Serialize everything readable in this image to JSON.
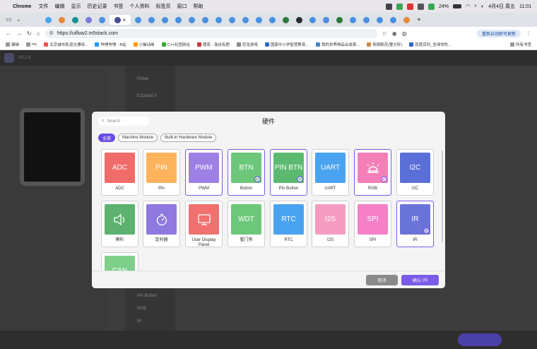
{
  "menubar": {
    "app": "Chrome",
    "items": [
      "文件",
      "编辑",
      "显示",
      "历史记录",
      "书签",
      "个人资料",
      "标签页",
      "窗口",
      "帮助"
    ],
    "battery": "24%",
    "datetime": "4月4日 周五",
    "time": "11:01"
  },
  "browser": {
    "url": "https://uiflow2.m5stack.com",
    "update_label": "重新启动即可更新",
    "bookmarks": [
      "编辑",
      "mc",
      "北京城市轨道交通线...",
      "哔哩哔哩 - B站",
      "小猫动画",
      "C++社团网站",
      "题库 - 洛谷有题",
      "恐龙游戏",
      "国家中小学智慧教育...",
      "我的世界物品合成表...",
      "青钢梨花(曹文轩)",
      "百度百科_全球领先..."
    ],
    "all_bookmarks": "所有书签"
  },
  "app": {
    "version": "V2.2.6",
    "blocks": [
      "Power",
      "EzData2.0",
      "Pin Button",
      "RGB",
      "IR"
    ]
  },
  "modal": {
    "title": "硬件",
    "search_placeholder": "Search",
    "filters": [
      "全部",
      "Machine Module",
      "Built-in Hardware Module"
    ],
    "cards": [
      {
        "thumb": "ADC",
        "label": "ADC",
        "color": "#f26b6b",
        "selected": false
      },
      {
        "thumb": "PIN",
        "label": "Pin",
        "color": "#fdb45c",
        "selected": false
      },
      {
        "thumb": "PWM",
        "label": "PWM",
        "color": "#9d7fe6",
        "selected": true
      },
      {
        "thumb": "BTN",
        "label": "Button",
        "color": "#6cc77a",
        "selected": true
      },
      {
        "thumb": "PIN BTN",
        "label": "Pin Button",
        "color": "#5cba70",
        "selected": true
      },
      {
        "thumb": "UART",
        "label": "UART",
        "color": "#4aa3f0",
        "selected": false
      },
      {
        "thumb": "",
        "label": "RGB",
        "color": "#f580b8",
        "selected": true
      },
      {
        "thumb": "I2C",
        "label": "I2C",
        "color": "#5b6fd8",
        "selected": false
      },
      {
        "thumb": "",
        "label": "喇叭",
        "color": "#5cb26e",
        "selected": false
      },
      {
        "thumb": "",
        "label": "定时器",
        "color": "#8f78e0",
        "selected": false
      },
      {
        "thumb": "",
        "label": "User Display Panel",
        "color": "#f17070",
        "selected": false
      },
      {
        "thumb": "WDT",
        "label": "看门狗",
        "color": "#6cc77a",
        "selected": false
      },
      {
        "thumb": "RTC",
        "label": "RTC",
        "color": "#4aa3f0",
        "selected": false
      },
      {
        "thumb": "I2S",
        "label": "I2S",
        "color": "#f59cc0",
        "selected": false
      },
      {
        "thumb": "SPI",
        "label": "SPI",
        "color": "#f580c8",
        "selected": false
      },
      {
        "thumb": "IR",
        "label": "IR",
        "color": "#6a74d8",
        "selected": true
      },
      {
        "thumb": "CAN",
        "label": "",
        "color": "#7ecf8a",
        "selected": false
      }
    ],
    "cancel_label": "取消",
    "confirm_label": "确认",
    "confirm_count": "(4)"
  }
}
